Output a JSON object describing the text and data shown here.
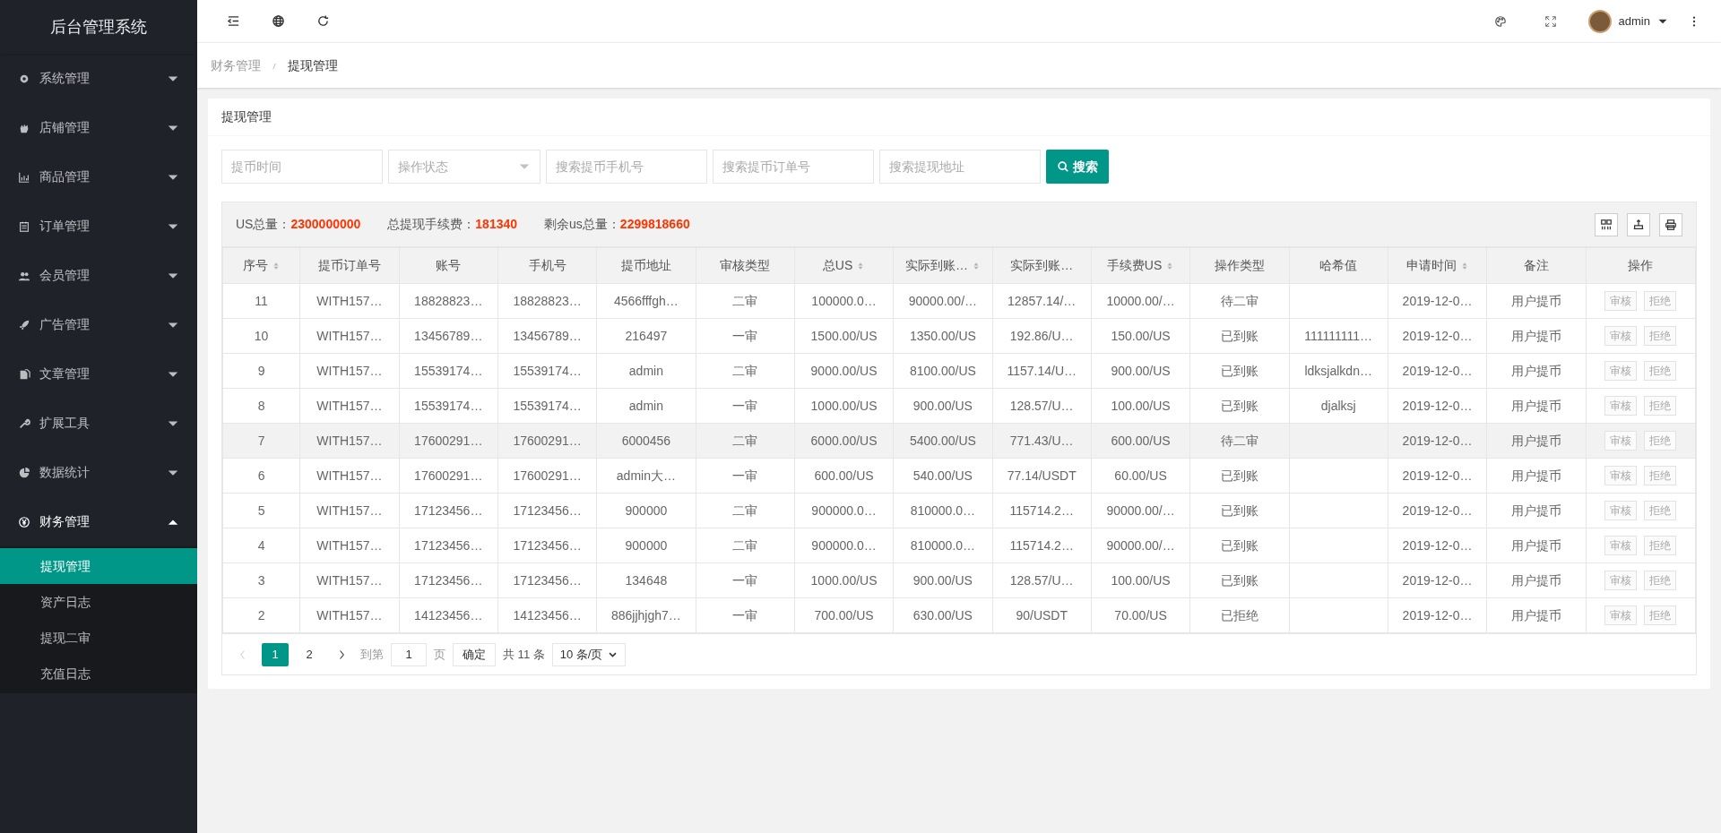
{
  "sidebar": {
    "title": "后台管理系统",
    "items": [
      {
        "label": "系统管理",
        "expanded": false
      },
      {
        "label": "店铺管理",
        "expanded": false
      },
      {
        "label": "商品管理",
        "expanded": false
      },
      {
        "label": "订单管理",
        "expanded": false
      },
      {
        "label": "会员管理",
        "expanded": false
      },
      {
        "label": "广告管理",
        "expanded": false
      },
      {
        "label": "文章管理",
        "expanded": false
      },
      {
        "label": "扩展工具",
        "expanded": false
      },
      {
        "label": "数据统计",
        "expanded": false
      },
      {
        "label": "财务管理",
        "expanded": true,
        "children": [
          {
            "label": "提现管理",
            "selected": true
          },
          {
            "label": "资产日志",
            "selected": false
          },
          {
            "label": "提现二审",
            "selected": false
          },
          {
            "label": "充值日志",
            "selected": false
          }
        ]
      }
    ]
  },
  "header": {
    "user": "admin"
  },
  "breadcrumb": [
    "财务管理",
    "提现管理"
  ],
  "card": {
    "title": "提现管理"
  },
  "filters": [
    {
      "kind": "input",
      "placeholder": "提币时间"
    },
    {
      "kind": "select",
      "placeholder": "操作状态"
    },
    {
      "kind": "input",
      "placeholder": "搜索提币手机号"
    },
    {
      "kind": "input",
      "placeholder": "搜索提币订单号"
    },
    {
      "kind": "input",
      "placeholder": "搜索提现地址"
    }
  ],
  "search_button": "搜索",
  "stats": [
    {
      "label": "US总量：",
      "value": "2300000000"
    },
    {
      "label": "总提现手续费：",
      "value": "181340"
    },
    {
      "label": "剩余us总量：",
      "value": "2299818660"
    }
  ],
  "table": {
    "columns": [
      {
        "label": "序号",
        "sortable": true
      },
      {
        "label": "提币订单号",
        "sortable": false
      },
      {
        "label": "账号",
        "sortable": false
      },
      {
        "label": "手机号",
        "sortable": false
      },
      {
        "label": "提币地址",
        "sortable": false
      },
      {
        "label": "审核类型",
        "sortable": false
      },
      {
        "label": "总US",
        "sortable": true
      },
      {
        "label": "实际到账…",
        "sortable": true
      },
      {
        "label": "实际到账…",
        "sortable": false
      },
      {
        "label": "手续费US",
        "sortable": true
      },
      {
        "label": "操作类型",
        "sortable": false
      },
      {
        "label": "哈希值",
        "sortable": false
      },
      {
        "label": "申请时间",
        "sortable": true
      },
      {
        "label": "备注",
        "sortable": false
      },
      {
        "label": "操作",
        "sortable": false
      }
    ],
    "rows": [
      {
        "selected": false,
        "cells": [
          "11",
          "WITH157…",
          "18828823…",
          "18828823…",
          "4566fffgh…",
          "二审",
          "100000.0…",
          "90000.00/…",
          "12857.14/…",
          "10000.00/…",
          "待二审",
          null,
          "2019-12-0…",
          "用户提币"
        ],
        "actions": [
          {
            "label": "审核",
            "disabled": true
          },
          {
            "label": "拒绝",
            "disabled": true
          }
        ]
      },
      {
        "selected": false,
        "cells": [
          "10",
          "WITH157…",
          "13456789…",
          "13456789…",
          "216497",
          "一审",
          "1500.00/US",
          "1350.00/US",
          "192.86/U…",
          "150.00/US",
          "已到账",
          "111111111…",
          "2019-12-0…",
          "用户提币"
        ],
        "actions": [
          {
            "label": "审核",
            "disabled": true
          },
          {
            "label": "拒绝",
            "disabled": true
          }
        ]
      },
      {
        "selected": false,
        "cells": [
          "9",
          "WITH157…",
          "15539174…",
          "15539174…",
          "admin",
          "二审",
          "9000.00/US",
          "8100.00/US",
          "1157.14/U…",
          "900.00/US",
          "已到账",
          "ldksjalkdn…",
          "2019-12-0…",
          "用户提币"
        ],
        "actions": [
          {
            "label": "审核",
            "disabled": true
          },
          {
            "label": "拒绝",
            "disabled": true
          }
        ]
      },
      {
        "selected": false,
        "cells": [
          "8",
          "WITH157…",
          "15539174…",
          "15539174…",
          "admin",
          "一审",
          "1000.00/US",
          "900.00/US",
          "128.57/U…",
          "100.00/US",
          "已到账",
          "djalksj",
          "2019-12-0…",
          "用户提币"
        ],
        "actions": [
          {
            "label": "审核",
            "disabled": true
          },
          {
            "label": "拒绝",
            "disabled": true
          }
        ]
      },
      {
        "selected": true,
        "cells": [
          "7",
          "WITH157…",
          "17600291…",
          "17600291…",
          "6000456",
          "二审",
          "6000.00/US",
          "5400.00/US",
          "771.43/U…",
          "600.00/US",
          "待二审",
          null,
          "2019-12-0…",
          "用户提币"
        ],
        "actions": [
          {
            "label": "审核",
            "disabled": true
          },
          {
            "label": "拒绝",
            "disabled": true
          }
        ]
      },
      {
        "selected": false,
        "cells": [
          "6",
          "WITH157…",
          "17600291…",
          "17600291…",
          "admin大…",
          "一审",
          "600.00/US",
          "540.00/US",
          "77.14/USDT",
          "60.00/US",
          "已到账",
          null,
          "2019-12-0…",
          "用户提币"
        ],
        "actions": [
          {
            "label": "审核",
            "disabled": true
          },
          {
            "label": "拒绝",
            "disabled": true
          }
        ]
      },
      {
        "selected": false,
        "cells": [
          "5",
          "WITH157…",
          "17123456…",
          "17123456…",
          "900000",
          "二审",
          "900000.0…",
          "810000.0…",
          "115714.2…",
          "90000.00/…",
          "已到账",
          null,
          "2019-12-0…",
          "用户提币"
        ],
        "actions": [
          {
            "label": "审核",
            "disabled": true
          },
          {
            "label": "拒绝",
            "disabled": true
          }
        ]
      },
      {
        "selected": false,
        "cells": [
          "4",
          "WITH157…",
          "17123456…",
          "17123456…",
          "900000",
          "二审",
          "900000.0…",
          "810000.0…",
          "115714.2…",
          "90000.00/…",
          "已到账",
          null,
          "2019-12-0…",
          "用户提币"
        ],
        "actions": [
          {
            "label": "审核",
            "disabled": true
          },
          {
            "label": "拒绝",
            "disabled": true
          }
        ]
      },
      {
        "selected": false,
        "cells": [
          "3",
          "WITH157…",
          "17123456…",
          "17123456…",
          "134648",
          "一审",
          "1000.00/US",
          "900.00/US",
          "128.57/U…",
          "100.00/US",
          "已到账",
          null,
          "2019-12-0…",
          "用户提币"
        ],
        "actions": [
          {
            "label": "审核",
            "disabled": true
          },
          {
            "label": "拒绝",
            "disabled": true
          }
        ]
      },
      {
        "selected": false,
        "cells": [
          "2",
          "WITH157…",
          "14123456…",
          "14123456…",
          "886jjhjgh7…",
          "一审",
          "700.00/US",
          "630.00/US",
          "90/USDT",
          "70.00/US",
          "已拒绝",
          null,
          "2019-12-0…",
          "用户提币"
        ],
        "actions": [
          {
            "label": "审核",
            "disabled": true
          },
          {
            "label": "拒绝",
            "disabled": true
          }
        ]
      }
    ]
  },
  "pagination": {
    "prev_disabled": true,
    "pages": [
      {
        "label": "1",
        "selected": true
      },
      {
        "label": "2",
        "selected": false
      }
    ],
    "goto_label": "到第",
    "goto_value": "1",
    "page_unit": "页",
    "confirm": "确定",
    "total": "共 11 条",
    "page_size": "10 条/页"
  }
}
